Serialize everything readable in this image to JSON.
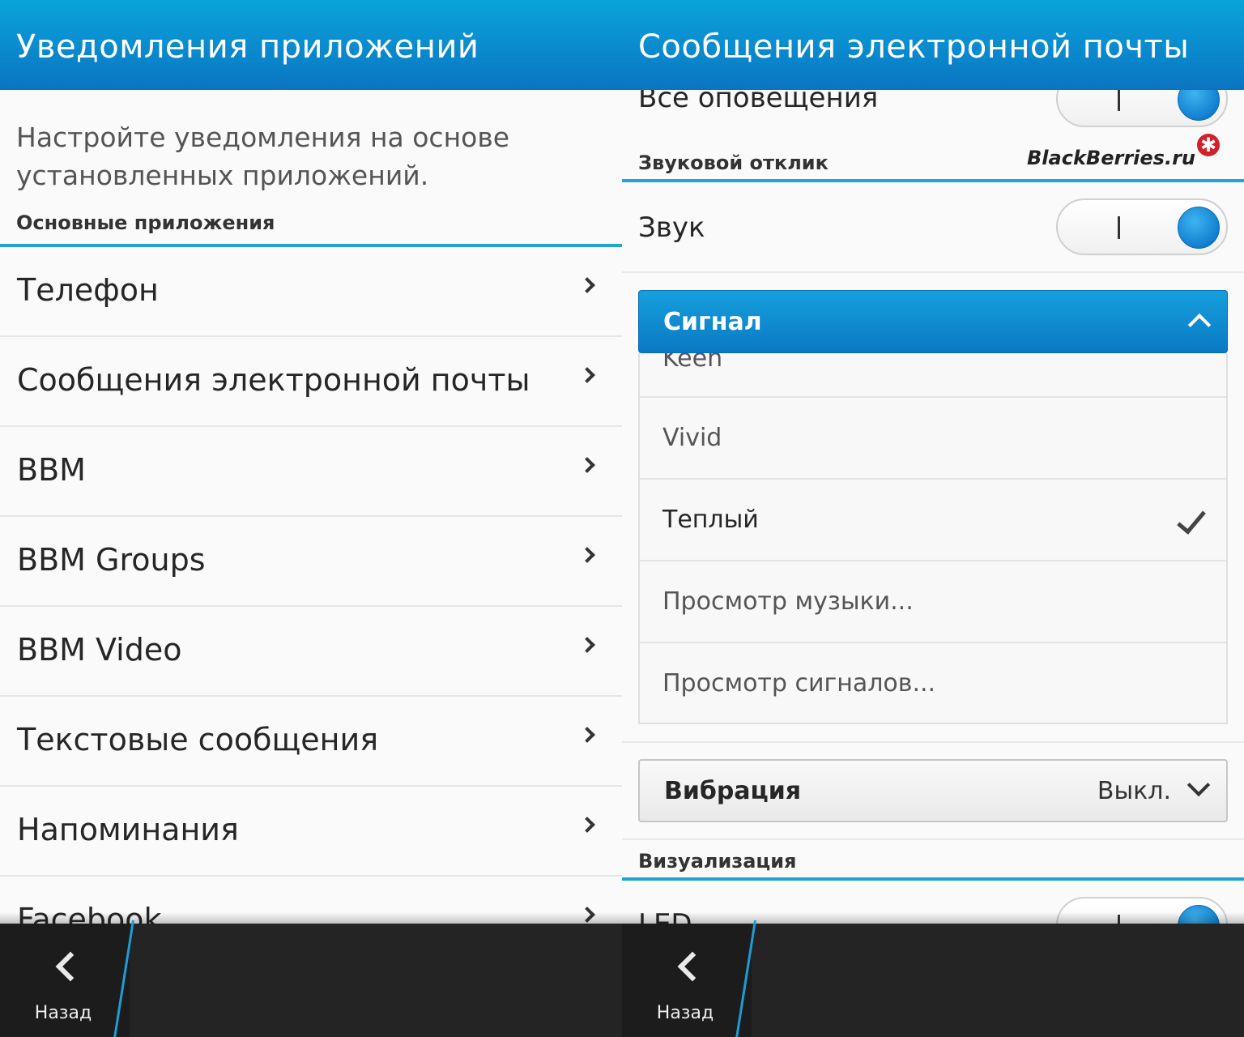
{
  "left": {
    "title": "Уведомления приложений",
    "intro": "Настройте уведомления на основе установленных приложений.",
    "section_header": "Основные приложения",
    "items": [
      {
        "label": "Телефон"
      },
      {
        "label": "Сообщения электронной почты"
      },
      {
        "label": "BBM"
      },
      {
        "label": "BBM Groups"
      },
      {
        "label": "BBM Video"
      },
      {
        "label": "Текстовые сообщения"
      },
      {
        "label": "Напоминания"
      },
      {
        "label": "Facebook"
      }
    ],
    "back_label": "Назад"
  },
  "right": {
    "title": "Сообщения электронной почты",
    "all_alerts_label": "Все оповещения",
    "all_alerts_on": true,
    "sound_section": "Звуковой отклик",
    "watermark": "BlackBerries.ru",
    "sound_label": "Звук",
    "sound_on": true,
    "signal_label": "Сигнал",
    "signal_options": [
      {
        "label": "Keen",
        "selected": false
      },
      {
        "label": "Vivid",
        "selected": false
      },
      {
        "label": "Теплый",
        "selected": true
      },
      {
        "label": "Просмотр музыки...",
        "selected": false
      },
      {
        "label": "Просмотр сигналов...",
        "selected": false
      }
    ],
    "vibration_label": "Вибрация",
    "vibration_value": "Выкл.",
    "visual_section": "Визуализация",
    "led_label": "LED",
    "led_on": true,
    "back_label": "Назад"
  },
  "colors": {
    "accent": "#0a8fd0",
    "section_line": "#1fa5cf",
    "bottom_bar": "#242424"
  }
}
